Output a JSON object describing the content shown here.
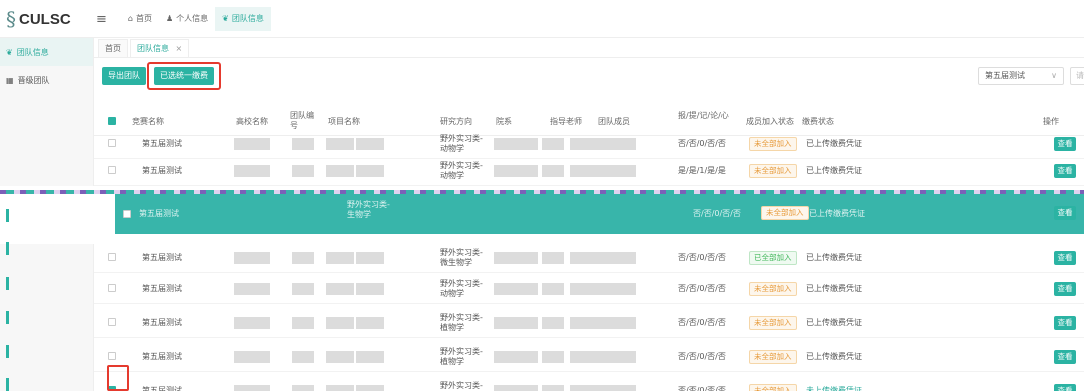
{
  "app": {
    "logo_mark": "§",
    "logo_text": "CULSC"
  },
  "topnav": [
    {
      "icon": "home-icon",
      "glyph": "⌂",
      "label": "首页",
      "active": false
    },
    {
      "icon": "user-icon",
      "glyph": "♟",
      "label": "个人信息",
      "active": false
    },
    {
      "icon": "team-icon",
      "glyph": "❦",
      "label": "团队信息",
      "active": true
    }
  ],
  "sidebar": [
    {
      "icon": "team-icon",
      "glyph": "❦",
      "label": "团队信息",
      "active": true
    },
    {
      "icon": "grid-icon",
      "glyph": "▦",
      "label": "晋级团队",
      "active": false
    }
  ],
  "tabs": [
    {
      "label": "首页",
      "active": false
    },
    {
      "label": "团队信息",
      "active": true,
      "close": "×"
    }
  ],
  "toolbar": {
    "export_label": "导出团队",
    "pay_label": "已选统一缴费",
    "season_value": "第五届测试",
    "chev": "∨",
    "search_cut": "请"
  },
  "table": {
    "headers": {
      "competition": "竞赛名称",
      "school": "高校名称",
      "team_no": "团队编号",
      "project": "项目名称",
      "direction": "研究方向",
      "department": "院系",
      "advisor": "指导老师",
      "members": "团队成员",
      "flags": "报/提/记/论/心",
      "join_status": "成员加入状态",
      "pay_status": "缴费状态",
      "action": "操作"
    },
    "rows": [
      {
        "competition": "第五届测试",
        "direction": "野外实习类-动物学",
        "flags": "否/否/0/否/否",
        "join": "未全部加入",
        "join_type": "partial",
        "pay": "已上传缴费凭证",
        "view": "查看",
        "checked": false
      },
      {
        "competition": "第五届测试",
        "direction": "野外实习类-动物学",
        "flags": "是/是/1/是/是",
        "join": "未全部加入",
        "join_type": "partial",
        "pay": "已上传缴费凭证",
        "view": "查看",
        "checked": false
      },
      {
        "competition": "第五届测试",
        "direction": "野外实习类-生物学",
        "flags": "否/否/0/否/否",
        "join": "未全部加入",
        "join_type": "partial",
        "pay": "已上传缴费凭证",
        "view": "查看",
        "checked": false
      },
      {
        "competition": "第五届测试",
        "direction": "野外实习类-微生物学",
        "flags": "否/否/0/否/否",
        "join": "已全部加入",
        "join_type": "full",
        "pay": "已上传缴费凭证",
        "view": "查看",
        "checked": false
      },
      {
        "competition": "第五届测试",
        "direction": "野外实习类-动物学",
        "flags": "否/否/0/否/否",
        "join": "未全部加入",
        "join_type": "partial",
        "pay": "已上传缴费凭证",
        "view": "查看",
        "checked": false
      },
      {
        "competition": "第五届测试",
        "direction": "野外实习类-植物学",
        "flags": "否/否/0/否/否",
        "join": "未全部加入",
        "join_type": "partial",
        "pay": "已上传缴费凭证",
        "view": "查看",
        "checked": false
      },
      {
        "competition": "第五届测试",
        "direction": "野外实习类-植物学",
        "flags": "否/否/0/否/否",
        "join": "未全部加入",
        "join_type": "partial",
        "pay": "已上传缴费凭证",
        "view": "查看",
        "checked": false
      },
      {
        "competition": "第五届测试",
        "direction": "野外实习类-微生物学",
        "flags": "否/否/0/否/否",
        "join": "未全部加入",
        "join_type": "partial",
        "pay": "未上传缴费凭证",
        "view": "查看",
        "checked": true
      }
    ]
  },
  "colors": {
    "accent": "#2bb3a3",
    "highlight": "#e53a2e",
    "partial": "#e69a3a",
    "full": "#43b85c"
  }
}
